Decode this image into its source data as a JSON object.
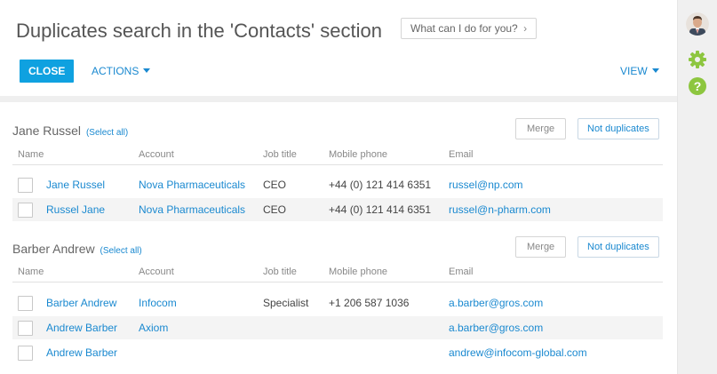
{
  "header": {
    "title": "Duplicates search in the 'Contacts' section",
    "help_prompt": "What can I do for you?",
    "help_chevron": "›"
  },
  "toolbar": {
    "close_label": "CLOSE",
    "actions_label": "ACTIONS",
    "view_label": "VIEW"
  },
  "columns": {
    "name": "Name",
    "account": "Account",
    "job_title": "Job title",
    "mobile_phone": "Mobile phone",
    "email": "Email"
  },
  "groups": [
    {
      "title": "Jane Russel",
      "select_all": "(Select all)",
      "merge_label": "Merge",
      "not_duplicates_label": "Not duplicates",
      "rows": [
        {
          "name": "Jane Russel",
          "account": "Nova Pharmaceuticals",
          "job_title": "CEO",
          "mobile_phone": "+44 (0) 121 414 6351",
          "email": "russel@np.com"
        },
        {
          "name": "Russel Jane",
          "account": "Nova Pharmaceuticals",
          "job_title": "CEO",
          "mobile_phone": "+44 (0) 121 414 6351",
          "email": "russel@n-pharm.com"
        }
      ]
    },
    {
      "title": "Barber Andrew",
      "select_all": "(Select all)",
      "merge_label": "Merge",
      "not_duplicates_label": "Not duplicates",
      "rows": [
        {
          "name": "Barber Andrew",
          "account": "Infocom",
          "job_title": "Specialist",
          "mobile_phone": "+1 206 587 1036",
          "email": "a.barber@gros.com"
        },
        {
          "name": "Andrew Barber",
          "account": "Axiom",
          "job_title": "",
          "mobile_phone": "",
          "email": "a.barber@gros.com"
        },
        {
          "name": "Andrew Barber",
          "account": "",
          "job_title": "",
          "mobile_phone": "",
          "email": "andrew@infocom-global.com"
        }
      ]
    }
  ],
  "right_bar": {
    "icons": [
      "user-avatar",
      "gear-icon",
      "help-icon"
    ],
    "gear_color": "#8dc63f",
    "help_color": "#8dc63f",
    "help_glyph": "?"
  },
  "colors": {
    "accent": "#0fa1e0",
    "link": "#1a89d0",
    "row_alt": "#f4f4f4"
  }
}
